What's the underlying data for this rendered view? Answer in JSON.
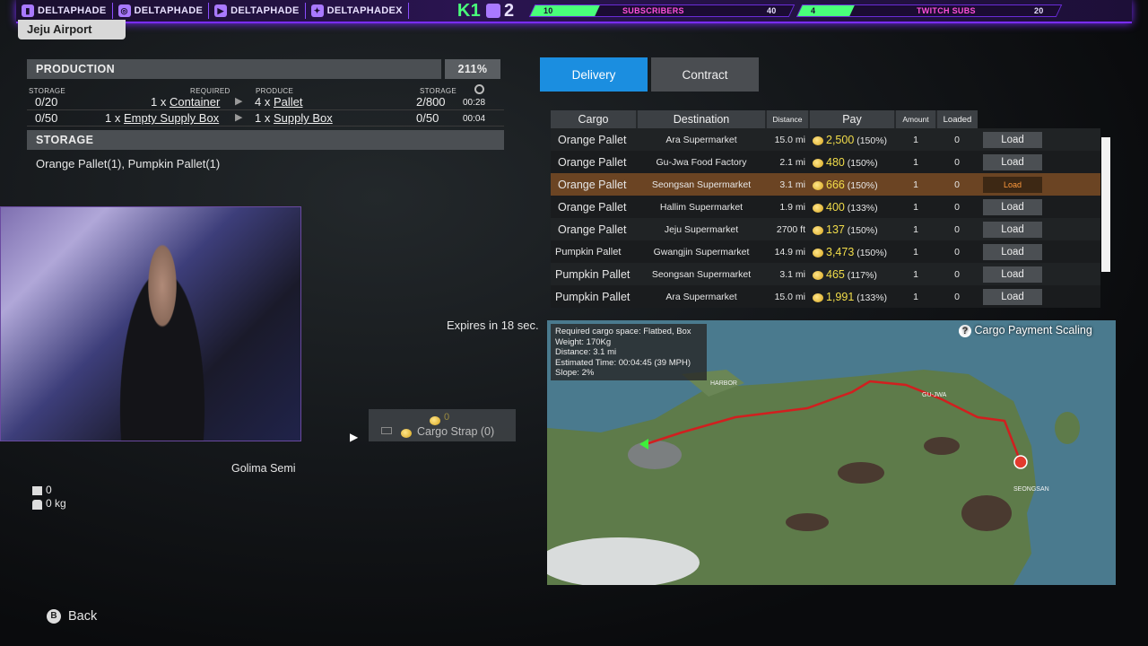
{
  "overlay": {
    "socials": [
      {
        "icon": "twitch-icon",
        "handle": "DELTAPHADE"
      },
      {
        "icon": "instagram-icon",
        "handle": "DELTAPHADE"
      },
      {
        "icon": "youtube-icon",
        "handle": "DELTAPHADE"
      },
      {
        "icon": "twitter-icon",
        "handle": "DELTAPHADEX"
      }
    ],
    "k1": "K1",
    "p2": "2",
    "subs": {
      "start": "10",
      "label": "SUBSCRIBERS",
      "goal": "40",
      "fraction": 0.25
    },
    "twitch_subs": {
      "start": "4",
      "label": "TWITCH SUBS",
      "goal": "20",
      "fraction": 0.2
    }
  },
  "location": "Jeju Airport",
  "production": {
    "title": "PRODUCTION",
    "percent": "211%",
    "col_storage": "STORAGE",
    "col_required": "REQUIRED",
    "col_produce": "PRODUCE",
    "col_storage2": "STORAGE",
    "rows": [
      {
        "storage_in": "0/20",
        "req_qty": "1 x",
        "req_item": "Container",
        "prod_qty": "4 x",
        "prod_item": "Pallet",
        "storage_out": "2/800",
        "time": "00:28"
      },
      {
        "storage_in": "0/50",
        "req_qty": "1 x",
        "req_item": "Empty Supply Box",
        "prod_qty": "1 x",
        "prod_item": "Supply Box",
        "storage_out": "0/50",
        "time": "00:04"
      }
    ]
  },
  "storage": {
    "title": "STORAGE",
    "contents": "Orange Pallet(1), Pumpkin Pallet(1)"
  },
  "vehicle": {
    "name": "Golima Semi",
    "boxes": "0",
    "weight": "0 kg",
    "strap_cost": "0",
    "strap_label": "Cargo Strap (0)"
  },
  "expires": "Expires in 18 sec.",
  "tabs": {
    "delivery": "Delivery",
    "contract": "Contract"
  },
  "columns": {
    "cargo": "Cargo",
    "destination": "Destination",
    "distance": "Distance",
    "pay": "Pay",
    "amount": "Amount",
    "loaded": "Loaded"
  },
  "rows": [
    {
      "cargo": "Orange Pallet",
      "dest": "Ara Supermarket",
      "dist": "15.0 mi",
      "pay": "2,500",
      "pct": "(150%)",
      "amount": "1",
      "loaded": "0",
      "action": "Load"
    },
    {
      "cargo": "Orange Pallet",
      "dest": "Gu-Jwa Food Factory",
      "dist": "2.1 mi",
      "pay": "480",
      "pct": "(150%)",
      "amount": "1",
      "loaded": "0",
      "action": "Load"
    },
    {
      "cargo": "Orange Pallet",
      "dest": "Seongsan Supermarket",
      "dist": "3.1 mi",
      "pay": "666",
      "pct": "(150%)",
      "amount": "1",
      "loaded": "0",
      "action": "Load"
    },
    {
      "cargo": "Orange Pallet",
      "dest": "Hallim Supermarket",
      "dist": "1.9 mi",
      "pay": "400",
      "pct": "(133%)",
      "amount": "1",
      "loaded": "0",
      "action": "Load"
    },
    {
      "cargo": "Orange Pallet",
      "dest": "Jeju Supermarket",
      "dist": "2700 ft",
      "pay": "137",
      "pct": "(150%)",
      "amount": "1",
      "loaded": "0",
      "action": "Load"
    },
    {
      "cargo": "Pumpkin Pallet",
      "dest": "Gwangjin Supermarket",
      "dist": "14.9 mi",
      "pay": "3,473",
      "pct": "(150%)",
      "amount": "1",
      "loaded": "0",
      "action": "Load"
    },
    {
      "cargo": "Pumpkin Pallet",
      "dest": "Seongsan Supermarket",
      "dist": "3.1 mi",
      "pay": "465",
      "pct": "(117%)",
      "amount": "1",
      "loaded": "0",
      "action": "Load"
    },
    {
      "cargo": "Pumpkin Pallet",
      "dest": "Ara Supermarket",
      "dist": "15.0 mi",
      "pay": "1,991",
      "pct": "(133%)",
      "amount": "1",
      "loaded": "0",
      "action": "Load"
    }
  ],
  "selected_row": 2,
  "map_info": {
    "space": "Required cargo space: Flatbed, Box",
    "weight": "Weight: 170Kg",
    "distance": "Distance: 3.1 mi",
    "time": "Estimated Time: 00:04:45 (39 MPH)",
    "slope": "Slope: 2%"
  },
  "scaling": "Cargo Payment Scaling",
  "map_labels": [
    "HARBOR",
    "GU-JWA",
    "SEONGSAN"
  ],
  "back": {
    "key": "B",
    "label": "Back"
  }
}
